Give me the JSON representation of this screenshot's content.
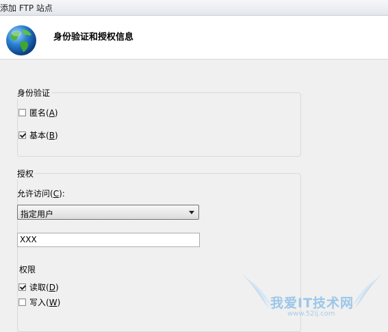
{
  "window": {
    "title": "添加 FTP 站点"
  },
  "header": {
    "title": "身份验证和授权信息"
  },
  "auth_group": {
    "legend": "身份验证",
    "anonymous": {
      "label": "匿名",
      "key": "A",
      "checked": false
    },
    "basic": {
      "label": "基本",
      "key": "B",
      "checked": true
    }
  },
  "authz_group": {
    "legend": "授权",
    "allow_access": {
      "label": "允许访问",
      "key": "C",
      "suffix": ":"
    },
    "select": {
      "value": "指定用户"
    },
    "users_input": {
      "value": "XXX"
    },
    "permissions_label": "权限",
    "read": {
      "label": "读取",
      "key": "D",
      "checked": true
    },
    "write": {
      "label": "写入",
      "key": "W",
      "checked": false
    }
  },
  "watermark": {
    "text": "我爱IT技术网",
    "url": "www.52ij.com"
  },
  "colors": {
    "header_bg": "#ffffff",
    "window_bg": "#f0f0f0",
    "watermark": "#9cc6e8"
  }
}
